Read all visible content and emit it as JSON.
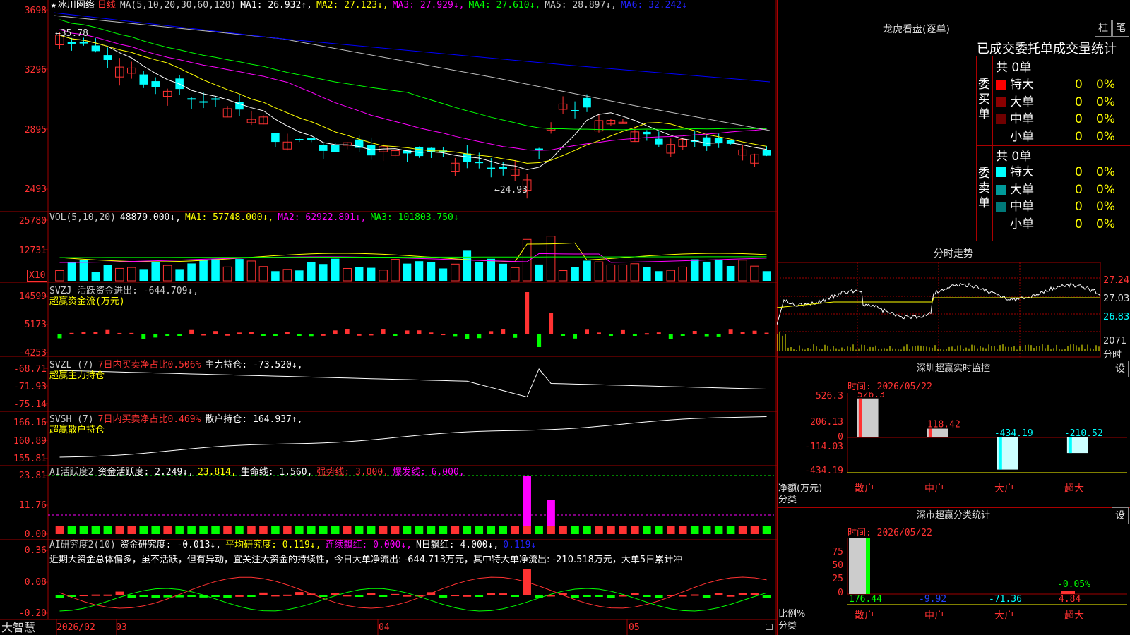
{
  "main": {
    "k_header": {
      "star": "★",
      "name": "冰川网络",
      "period": "日线",
      "ma_label": "MA(5,10,20,30,60,120)",
      "ma1": "MA1: 26.932↑,",
      "ma2": "MA2: 27.123↓,",
      "ma3": "MA3: 27.929↓,",
      "ma4": "MA4: 27.610↓,",
      "ma5": "MA5: 28.897↓,",
      "ma6": "MA6: 32.242↓"
    },
    "k_axis": [
      "3698",
      "3296",
      "2895",
      "2493"
    ],
    "k_annot_high": "35.78",
    "k_annot_low": "←24.93",
    "vol_header": {
      "label": "VOL(5,10,20)",
      "value": "48879.000↓,",
      "ma1": "MA1: 57748.000↓,",
      "ma2": "MA2: 62922.801↓,",
      "ma3": "MA3: 101803.750↓"
    },
    "vol_axis": [
      "25780",
      "12731"
    ],
    "vol_unit": "X10",
    "svzj_header": {
      "title": "SVZJ  活跃资金进出: -644.709↓,",
      "sub": "超赢资金流(万元)"
    },
    "svzj_axis": [
      "14599",
      "5173",
      "-4253"
    ],
    "svzl_header": {
      "title": "SVZL (7)",
      "ratio": "7日内买卖净占比0.506%",
      "pos": "主力持仓: -73.520↓,",
      "sub": "超赢主力持仓"
    },
    "svzl_axis": [
      "-68.71",
      "-71.93",
      "-75.14"
    ],
    "svsh_header": {
      "title": "SVSH (7)",
      "ratio": "7日内买卖净占比0.469%",
      "pos": "散户持仓: 164.937↑,",
      "sub": "超赢散户持仓"
    },
    "svsh_axis": [
      "166.16",
      "160.89",
      "155.81"
    ],
    "ai1_header": {
      "title": "AI活跃度2",
      "a": "资金活跃度: 2.249↓,",
      "b": "23.814,",
      "c": "生命线: 1.560,",
      "d": "强势线: 3.000,",
      "e": "爆发线: 6.000,"
    },
    "ai1_axis": [
      "23.81",
      "11.76",
      "0.00"
    ],
    "ai2_header": {
      "title": "AI研究度2(10)",
      "a": "资金研究度: -0.013↓,",
      "b": "平均研究度: 0.119↓,",
      "c": "连续飘红: 0.000↓,",
      "d": "N日飘红: 4.000↓,",
      "e": "0.119↓"
    },
    "ai2_text": "近期大资金总体偏多，虽不活跃，但有异动，宜关注大资金的持续性，今日大单净流出: -644.713万元，其中特大单净流出: -210.518万元，大单5日累计冲",
    "ai2_axis": [
      "0.36",
      "0.08",
      "-0.20"
    ],
    "footer": {
      "brand": "大智慧",
      "dates": [
        "2026/02",
        "03",
        "04",
        "05"
      ]
    }
  },
  "lhb": {
    "title": "龙虎看盘(逐单)",
    "tab1": "柱",
    "tab2": "笔",
    "subtitle": "已成交委托单成交量统计",
    "buy_label": "委买单",
    "sell_label": "委卖单",
    "buy_total": "共 0单",
    "sell_total": "共 0单",
    "buy_rows": [
      {
        "name": "特大",
        "qty": "0",
        "pct": "0%",
        "color": "#ff0000"
      },
      {
        "name": "大单",
        "qty": "0",
        "pct": "0%",
        "color": "#8b0000"
      },
      {
        "name": "中单",
        "qty": "0",
        "pct": "0%",
        "color": "#700000"
      },
      {
        "name": "小单",
        "qty": "0",
        "pct": "0%",
        "color": "#000000"
      }
    ],
    "sell_rows": [
      {
        "name": "特大",
        "qty": "0",
        "pct": "0%",
        "color": "#00ffff"
      },
      {
        "name": "大单",
        "qty": "0",
        "pct": "0%",
        "color": "#009a9a"
      },
      {
        "name": "中单",
        "qty": "0",
        "pct": "0%",
        "color": "#007878"
      },
      {
        "name": "小单",
        "qty": "0",
        "pct": "0%",
        "color": "#000000"
      }
    ]
  },
  "intraday": {
    "title": "分时走势",
    "axis": [
      "27.24",
      "27.03",
      "26.83",
      "2071",
      "分时"
    ]
  },
  "monitor": {
    "title": "深圳超赢实时监控",
    "set_btn": "设",
    "time": "时间: 2026/05/22",
    "axis": [
      "526.3",
      "206.13",
      "0",
      "-114.03",
      "-434.19"
    ],
    "left_labels": [
      "净额(万元)",
      "分类"
    ],
    "bars": [
      {
        "cat": "散户",
        "value": 526.3,
        "label": "526.3"
      },
      {
        "cat": "中户",
        "value": 118.42,
        "label": "118.42"
      },
      {
        "cat": "大户",
        "value": -434.19,
        "label": "-434.19"
      },
      {
        "cat": "超大",
        "value": -210.52,
        "label": "-210.52"
      }
    ]
  },
  "classify": {
    "title": "深市超赢分类统计",
    "set_btn": "设",
    "time": "时间: 2026/05/22",
    "axis": [
      "75",
      "50",
      "25",
      "0"
    ],
    "left_labels": [
      "比例%",
      "分类"
    ],
    "top_label": "-0.05%",
    "bars": [
      {
        "cat": "散户",
        "value": 176.44,
        "label": "176.44"
      },
      {
        "cat": "中户",
        "value": -9.92,
        "label": "-9.92"
      },
      {
        "cat": "大户",
        "value": -71.36,
        "label": "-71.36"
      },
      {
        "cat": "超大",
        "value": 4.84,
        "label": "4.84"
      }
    ]
  },
  "colors": {
    "up": "#ff3232",
    "down": "#00ffff",
    "grid": "#a00000",
    "ma1": "#ffffff",
    "ma2": "#ffff00",
    "ma3": "#ff00ff",
    "ma4": "#00ff00",
    "ma5": "#c0c0c0",
    "ma6": "#0000ff"
  }
}
